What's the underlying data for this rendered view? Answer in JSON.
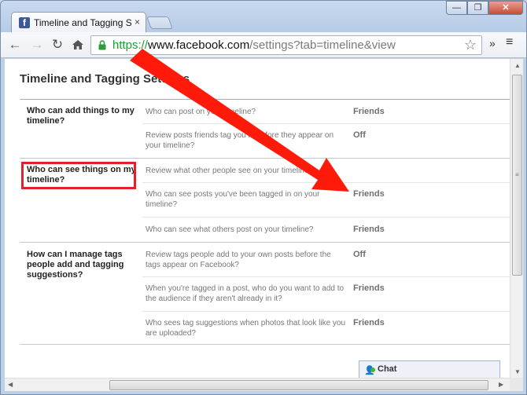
{
  "browser": {
    "tab_title": "Timeline and Tagging Setti",
    "tab_close": "×",
    "favicon_letter": "f",
    "url_scheme": "https://",
    "url_host": "www.facebook.com",
    "url_path": "/settings?tab=timeline&view",
    "window_buttons": {
      "minimize": "—",
      "restore": "❐",
      "close": "✕"
    },
    "overflow": "»",
    "menu": "≡"
  },
  "page": {
    "title": "Timeline and Tagging Settings",
    "sections": [
      {
        "label": "Who can add things to my timeline?",
        "items": [
          {
            "text": "Who can post on your timeline?",
            "value": "Friends"
          },
          {
            "text": "Review posts friends tag you in before they appear on your timeline?",
            "value": "Off"
          }
        ]
      },
      {
        "label": "Who can see things on my timeline?",
        "items": [
          {
            "text": "Review what other people see on your timeline",
            "value": ""
          },
          {
            "text": "Who can see posts you've been tagged in on your timeline?",
            "value": "Friends"
          },
          {
            "text": "Who can see what others post on your timeline?",
            "value": "Friends"
          }
        ]
      },
      {
        "label": "How can I manage tags people add and tagging suggestions?",
        "items": [
          {
            "text": "Review tags people add to your own posts before the tags appear on Facebook?",
            "value": "Off"
          },
          {
            "text": "When you're tagged in a post, who do you want to add to the audience if they aren't already in it?",
            "value": "Friends"
          },
          {
            "text": "Who sees tag suggestions when photos that look like you are uploaded?",
            "value": "Friends"
          }
        ]
      }
    ],
    "chat_label": "Chat"
  },
  "colors": {
    "highlight": "#e2202a",
    "facebook_blue": "#3b5998",
    "secure_green": "#1a9f2e"
  }
}
